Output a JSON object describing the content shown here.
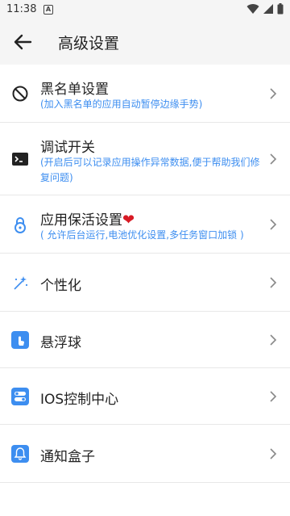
{
  "status": {
    "time": "11:38",
    "notif_letter": "A"
  },
  "header": {
    "title": "高级设置"
  },
  "items": [
    {
      "title": "黑名单设置",
      "subtitle": "(加入黑名单的应用自动暂停边缘手势)",
      "icon": "block-icon"
    },
    {
      "title": "调试开关",
      "subtitle": "(开启后可以记录应用操作异常数据,便于帮助我们修复问题)",
      "icon": "terminal-icon"
    },
    {
      "title": "应用保活设置",
      "title_suffix": "❤",
      "subtitle": "( 允许后台运行,电池优化设置,多任务窗口加锁 )",
      "icon": "lock-icon"
    },
    {
      "title": "个性化",
      "icon": "magic-wand-icon"
    },
    {
      "title": "悬浮球",
      "icon": "touch-icon"
    },
    {
      "title": "IOS控制中心",
      "icon": "toggle-panel-icon"
    },
    {
      "title": "通知盒子",
      "icon": "bell-icon"
    }
  ],
  "colors": {
    "accent": "#3d8ef0",
    "heart": "#d81b25",
    "icon_bg": "#3d8ef0"
  }
}
